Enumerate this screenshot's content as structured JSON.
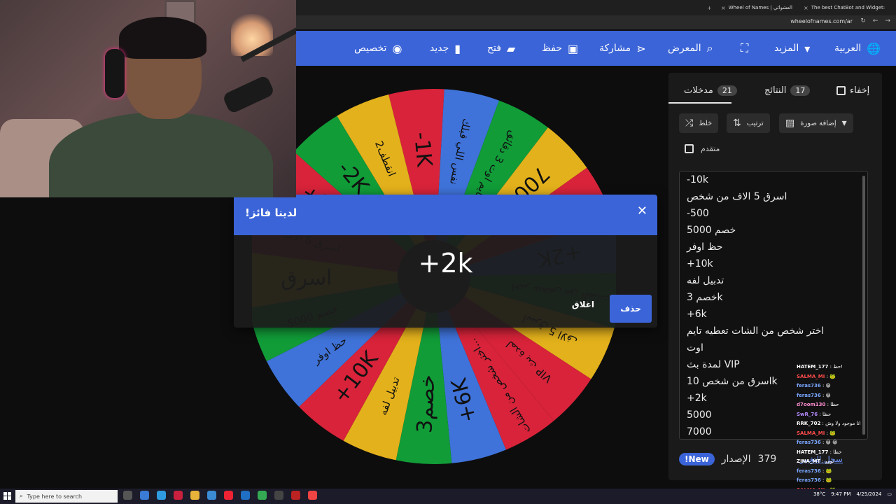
{
  "browser": {
    "tabs": [
      {
        "label": "The best ChatBot and Widget:"
      },
      {
        "label": "Wheel of Names | العشوائي"
      }
    ],
    "url": "wheelofnames.com/ar"
  },
  "nav": {
    "language": "العربية",
    "more": "المزيد",
    "gallery": "المعرض",
    "share": "مشاركة",
    "save": "حفظ",
    "open": "فتح",
    "new": "جديد",
    "customize": "تخصيص"
  },
  "wheel": {
    "slices": [
      {
        "label": "-1K",
        "color": "#d8233a"
      },
      {
        "label": "نفس اللي قبلك",
        "color": "#3f73d9"
      },
      {
        "label": "تايم اوت 3 دقائق",
        "color": "#119c38"
      },
      {
        "label": "7000",
        "color": "#e3b11c"
      },
      {
        "label": "-500",
        "color": "#d8233a"
      },
      {
        "label": "+2K",
        "color": "#3f73d9"
      },
      {
        "label": "اختر شخص من الشات",
        "color": "#119c38"
      },
      {
        "label": "اسرق 5 الاف",
        "color": "#e3b11c"
      },
      {
        "label": "VIP لمدة بث",
        "color": "#d8233a"
      },
      {
        "label": "اختر شخص من الشات...",
        "color": "#d8233a"
      },
      {
        "label": "+6K",
        "color": "#3f73d9"
      },
      {
        "label": "3خصم",
        "color": "#119c38"
      },
      {
        "label": "تدبيل لفه",
        "color": "#e3b11c"
      },
      {
        "label": "+10K",
        "color": "#d8233a"
      },
      {
        "label": "حظ اوفر",
        "color": "#3f73d9"
      },
      {
        "label": "5000 خصم",
        "color": "#119c38"
      },
      {
        "label": "اسرق",
        "color": "#e3b11c"
      },
      {
        "label": "اسرق 5 الاف",
        "color": "#d8233a"
      },
      {
        "label": "+500",
        "color": "#d8233a"
      },
      {
        "label": "-2K",
        "color": "#119c38"
      },
      {
        "label": "2انقطف",
        "color": "#e3b11c"
      }
    ]
  },
  "sidebar": {
    "entries_tab": "مدخلات",
    "entries_count": "21",
    "results_tab": "النتائج",
    "results_count": "17",
    "hide_label": "إخفاء",
    "add_image": "إضافة صورة",
    "sort": "ترتيب",
    "shuffle": "خلط",
    "advanced": "متقدم",
    "entries": [
      "-10k",
      "اسرق 5 الاف من شخص",
      "-500",
      "خصم 5000",
      "حظ اوفر",
      "+10k",
      "تدبيل لفه",
      "خصم 3k",
      "+6k",
      "اختر شخص من الشات تعطيه تايم",
      "اوت",
      "لمدة بث VIP",
      "اسرق من شخص 10k",
      "+2k",
      "5000",
      "7000"
    ],
    "version_label": "الإصدار",
    "version_number": "379",
    "new_badge": "New!",
    "changelog": "سجل التغيير"
  },
  "modal": {
    "title": "لدينا فائز!",
    "winner": "+2k",
    "remove": "حذف",
    "close": "اغلاق"
  },
  "chat": [
    {
      "user": "HATEM_177",
      "msg": ": حظ!",
      "color": "#ffffff"
    },
    {
      "user": "SALMA_MI",
      "msg": ": 🐸",
      "color": "#ff4b4b"
    },
    {
      "user": "feras736",
      "msg": ": 😀",
      "color": "#7aa7ff"
    },
    {
      "user": "feras736",
      "msg": ": 😀",
      "color": "#7aa7ff"
    },
    {
      "user": "d7oom130",
      "msg": ": حظا",
      "color": "#ff8fd2"
    },
    {
      "user": "SwR_76",
      "msg": ": حظا",
      "color": "#b68bff"
    },
    {
      "user": "RRK_702",
      "msg": ": انا موجود ولا وش",
      "color": "#ffffff"
    },
    {
      "user": "SALMA_MI",
      "msg": ": 🐸",
      "color": "#ff4b4b"
    },
    {
      "user": "feras736",
      "msg": ": 😀 😀",
      "color": "#7aa7ff"
    },
    {
      "user": "HATEM_177",
      "msg": ": حظا",
      "color": "#ffffff"
    },
    {
      "user": "ZINA_MT",
      "msg": ": تووو",
      "color": "#ffffff"
    },
    {
      "user": "feras736",
      "msg": ": 🐸",
      "color": "#7aa7ff"
    },
    {
      "user": "feras736",
      "msg": ": 🐸",
      "color": "#7aa7ff"
    },
    {
      "user": "SALMA_MI",
      "msg": ": 🐸",
      "color": "#ff4b4b"
    }
  ],
  "taskbar": {
    "search_placeholder": "Type here to search",
    "weather": "38°C",
    "time": "9:47 PM",
    "date": "4/25/2024"
  }
}
